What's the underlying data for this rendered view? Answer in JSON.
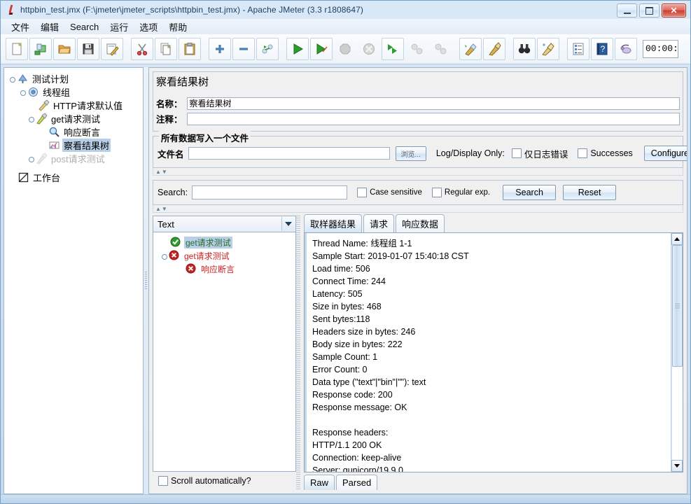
{
  "window": {
    "title": "httpbin_test.jmx (F:\\jmeter\\jmeter_scripts\\httpbin_test.jmx) - Apache JMeter (3.3 r1808647)",
    "minimize_label": "Minimize",
    "maximize_label": "Maximize",
    "close_label": "✕"
  },
  "menubar": {
    "items": [
      {
        "label": "文件",
        "name": "menu-file"
      },
      {
        "label": "编辑",
        "name": "menu-edit"
      },
      {
        "label": "Search",
        "name": "menu-search"
      },
      {
        "label": "运行",
        "name": "menu-run"
      },
      {
        "label": "选项",
        "name": "menu-options"
      },
      {
        "label": "帮助",
        "name": "menu-help"
      }
    ]
  },
  "toolbar": {
    "buttons": [
      {
        "icon": "new-file-icon",
        "title": "New"
      },
      {
        "icon": "templates-icon",
        "title": "Templates"
      },
      {
        "icon": "open-folder-icon",
        "title": "Open"
      },
      {
        "icon": "save-icon",
        "title": "Save"
      },
      {
        "icon": "save-as-icon",
        "title": "Save As"
      },
      {
        "icon": "cut-icon",
        "title": "Cut"
      },
      {
        "icon": "copy-icon",
        "title": "Copy"
      },
      {
        "icon": "paste-icon",
        "title": "Paste"
      },
      {
        "icon": "expand-all-icon",
        "title": "Expand All"
      },
      {
        "icon": "collapse-all-icon",
        "title": "Collapse All"
      },
      {
        "icon": "toggle-icon",
        "title": "Toggle"
      },
      {
        "icon": "start-icon",
        "title": "Start"
      },
      {
        "icon": "start-no-pause-icon",
        "title": "Start no pauses"
      },
      {
        "icon": "stop-icon",
        "title": "Stop"
      },
      {
        "icon": "shutdown-icon",
        "title": "Shutdown"
      },
      {
        "icon": "remote-start-all-icon",
        "title": "Remote Start All"
      },
      {
        "icon": "remote-stop-all-icon",
        "title": "Remote Stop All"
      },
      {
        "icon": "remote-shutdown-all-icon",
        "title": "Remote Shutdown All"
      },
      {
        "icon": "clear-icon",
        "title": "Clear"
      },
      {
        "icon": "clear-all-icon",
        "title": "Clear All"
      },
      {
        "icon": "search-binoculars-icon",
        "title": "Search"
      },
      {
        "icon": "search-reset-icon",
        "title": "Reset Search"
      },
      {
        "icon": "function-helper-icon",
        "title": "Function Helper Dialog"
      },
      {
        "icon": "help-icon",
        "title": "Help"
      },
      {
        "icon": "sound-icon",
        "title": "Sound"
      }
    ],
    "timer_value": "00:00:"
  },
  "test_plan_tree": {
    "nodes": [
      {
        "label": "测试计划",
        "icon": "test-plan-icon",
        "depth": 0,
        "selected": false,
        "disabled": false,
        "handle": true
      },
      {
        "label": "线程组",
        "icon": "thread-group-icon",
        "depth": 1,
        "selected": false,
        "disabled": false,
        "handle": true
      },
      {
        "label": "HTTP请求默认值",
        "icon": "config-element-icon",
        "depth": 2,
        "selected": false,
        "disabled": false,
        "handle": false
      },
      {
        "label": "get请求测试",
        "icon": "http-sampler-icon",
        "depth": 2,
        "selected": false,
        "disabled": false,
        "handle": true
      },
      {
        "label": "响应断言",
        "icon": "assertion-icon",
        "depth": 3,
        "selected": false,
        "disabled": false,
        "handle": false
      },
      {
        "label": "察看结果树",
        "icon": "view-results-tree-icon",
        "depth": 3,
        "selected": true,
        "disabled": false,
        "handle": false
      },
      {
        "label": "post请求测试",
        "icon": "http-sampler-icon",
        "depth": 2,
        "selected": false,
        "disabled": true,
        "handle": true
      },
      {
        "label": "工作台",
        "icon": "workbench-icon",
        "depth": 0,
        "selected": false,
        "disabled": false,
        "handle": false
      }
    ]
  },
  "panel": {
    "title": "察看结果树",
    "name_label": "名称：",
    "name_value": "察看结果树",
    "comment_label": "注释：",
    "comment_value": "",
    "file_group": {
      "legend": "所有数据写入一个文件",
      "filename_label": "文件名",
      "filename_value": "",
      "browse_label": "浏览...",
      "log_display_label": "Log/Display Only:",
      "errors_only_label": "仅日志错误",
      "successes_label": "Successes",
      "configure_label": "Configure"
    },
    "search_bar": {
      "search_label": "Search:",
      "search_value": "",
      "case_sensitive_label": "Case sensitive",
      "regular_exp_label": "Regular exp.",
      "search_button_label": "Search",
      "reset_button_label": "Reset"
    }
  },
  "results": {
    "renderer_selected": "Text",
    "tree_items": [
      {
        "label": "get请求测试",
        "status": "success",
        "depth": 1,
        "selected": true,
        "handle": false
      },
      {
        "label": "get请求测试",
        "status": "error",
        "depth": 1,
        "selected": false,
        "handle": true
      },
      {
        "label": "响应断言",
        "status": "error",
        "depth": 2,
        "selected": false,
        "handle": false
      }
    ],
    "scroll_automatically_label": "Scroll automatically?",
    "tabs": [
      {
        "label": "取样器结果",
        "active": true
      },
      {
        "label": "请求",
        "active": false
      },
      {
        "label": "响应数据",
        "active": false
      }
    ],
    "sampler_result_text": "Thread Name: 线程组 1-1\nSample Start: 2019-01-07 15:40:18 CST\nLoad time: 506\nConnect Time: 244\nLatency: 505\nSize in bytes: 468\nSent bytes:118\nHeaders size in bytes: 246\nBody size in bytes: 222\nSample Count: 1\nError Count: 0\nData type (\"text\"|\"bin\"|\"\"): text\nResponse code: 200\nResponse message: OK\n\nResponse headers:\nHTTP/1.1 200 OK\nConnection: keep-alive\nServer: gunicorn/19.9.0",
    "bottom_tabs": [
      {
        "label": "Raw",
        "active": true
      },
      {
        "label": "Parsed",
        "active": false
      }
    ]
  },
  "colors": {
    "accent": "#b7d0e8",
    "success": "#2e9b2e",
    "error": "#cc2222",
    "title_text": "#1d3f63"
  }
}
